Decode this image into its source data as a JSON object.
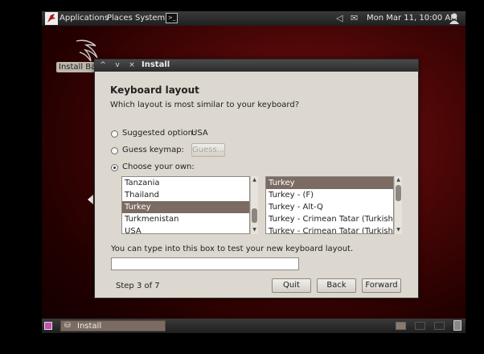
{
  "top_panel": {
    "menus": [
      "Applications",
      "Places",
      "System"
    ],
    "clock": "Mon Mar 11, 10:00 AM"
  },
  "desktop": {
    "icon_label": "Install BackTrack"
  },
  "window": {
    "title": "Install",
    "controls": [
      "^",
      "v",
      "×"
    ],
    "heading": "Keyboard layout",
    "question": "Which layout is most similar to your keyboard?",
    "suggested_label": "Suggested option:",
    "suggested_value": "USA",
    "guess_label": "Guess keymap:",
    "guess_button": "Guess...",
    "choose_label": "Choose your own:",
    "selected_option": "choose_own",
    "countries": [
      "Tanzania",
      "Thailand",
      "Turkey",
      "Turkmenistan",
      "USA"
    ],
    "selected_country": "Turkey",
    "layouts": [
      "Turkey",
      "Turkey - (F)",
      "Turkey - Alt-Q",
      "Turkey - Crimean Tatar (Turkish Alt-Q)",
      "Turkey - Crimean Tatar (Turkish F)"
    ],
    "selected_layout": "Turkey",
    "test_prompt": "You can type into this box to test your new keyboard layout.",
    "test_value": "",
    "step": "Step 3 of 7",
    "quit_button": "Quit",
    "back_button": "Back",
    "forward_button": "Forward"
  },
  "bottom_panel": {
    "task_label": "Install"
  },
  "colors": {
    "panel": "#2c2c2c",
    "selection": "#7b6b62",
    "window_bg": "#dcd8d0"
  }
}
